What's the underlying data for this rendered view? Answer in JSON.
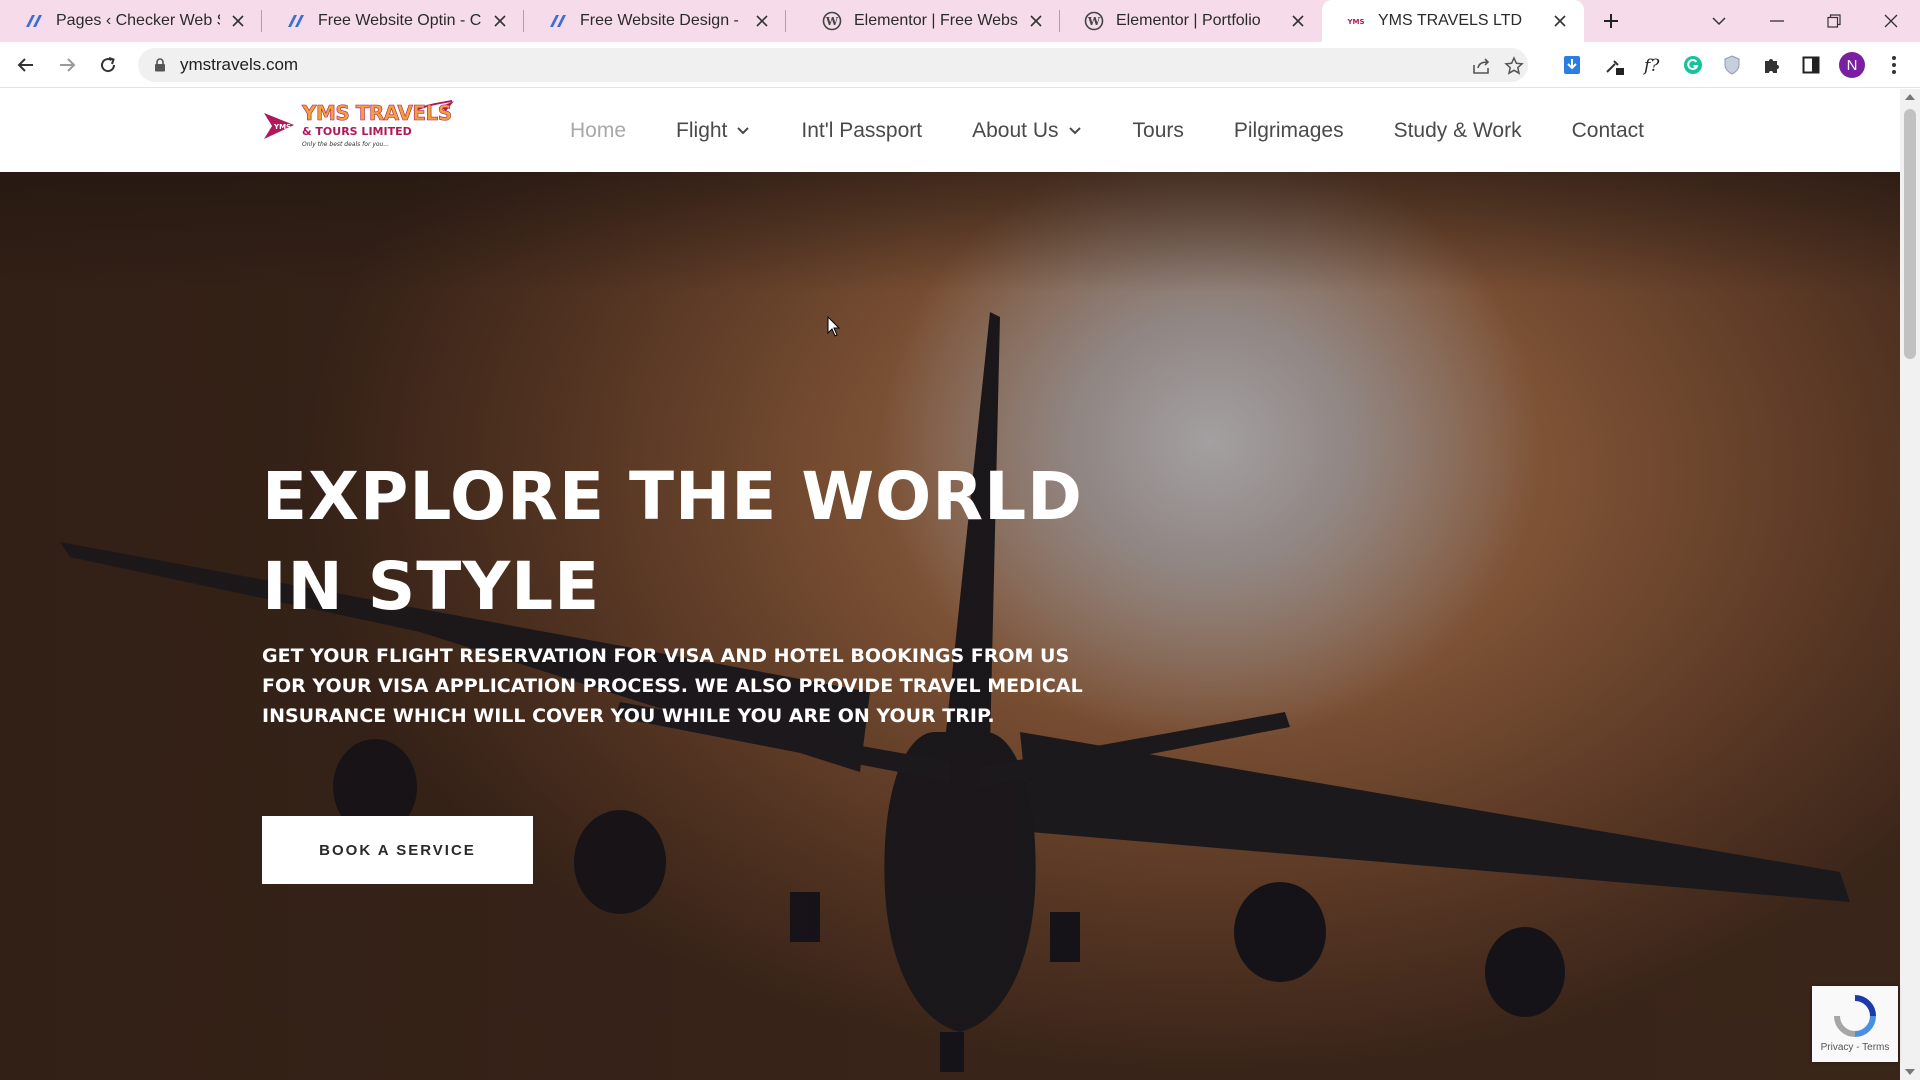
{
  "browser": {
    "tabs": [
      {
        "title": "Pages ‹ Checker Web Servic",
        "icon": "astra-icon",
        "active": false
      },
      {
        "title": "Free Website Optin - Check",
        "icon": "astra-icon",
        "active": false
      },
      {
        "title": "Free Website Design - Chec",
        "icon": "astra-icon",
        "active": false
      },
      {
        "title": "Elementor | Free Website D",
        "icon": "wordpress-icon",
        "active": false
      },
      {
        "title": "Elementor | Portfolio",
        "icon": "wordpress-icon",
        "active": false
      },
      {
        "title": "YMS TRAVELS LTD",
        "icon": "yms-icon",
        "active": true
      }
    ],
    "url": "ymstravels.com",
    "profile_initial": "N",
    "accent": "#f6dcea"
  },
  "site": {
    "logo_text": "YMS TRAVELS",
    "logo_subtext": "& TOURS LIMITED",
    "logo_tagline": "Only the best deals for you...",
    "logo_badge": "YMS",
    "nav": [
      {
        "label": "Home",
        "current": true,
        "dropdown": false
      },
      {
        "label": "Flight",
        "current": false,
        "dropdown": true
      },
      {
        "label": "Int'l Passport",
        "current": false,
        "dropdown": false
      },
      {
        "label": "About Us",
        "current": false,
        "dropdown": true
      },
      {
        "label": "Tours",
        "current": false,
        "dropdown": false
      },
      {
        "label": "Pilgrimages",
        "current": false,
        "dropdown": false
      },
      {
        "label": "Study & Work",
        "current": false,
        "dropdown": false
      },
      {
        "label": "Contact",
        "current": false,
        "dropdown": false
      }
    ],
    "hero": {
      "title_line1": "EXPLORE THE WORLD",
      "title_line2": "IN STYLE",
      "subtitle": "GET YOUR FLIGHT RESERVATION FOR VISA AND HOTEL BOOKINGS FROM US FOR YOUR VISA APPLICATION PROCESS. WE ALSO PROVIDE TRAVEL MEDICAL INSURANCE WHICH WILL COVER YOU WHILE YOU ARE ON YOUR TRIP.",
      "cta_label": "BOOK A SERVICE"
    },
    "recaptcha_text": "Privacy - Terms"
  }
}
